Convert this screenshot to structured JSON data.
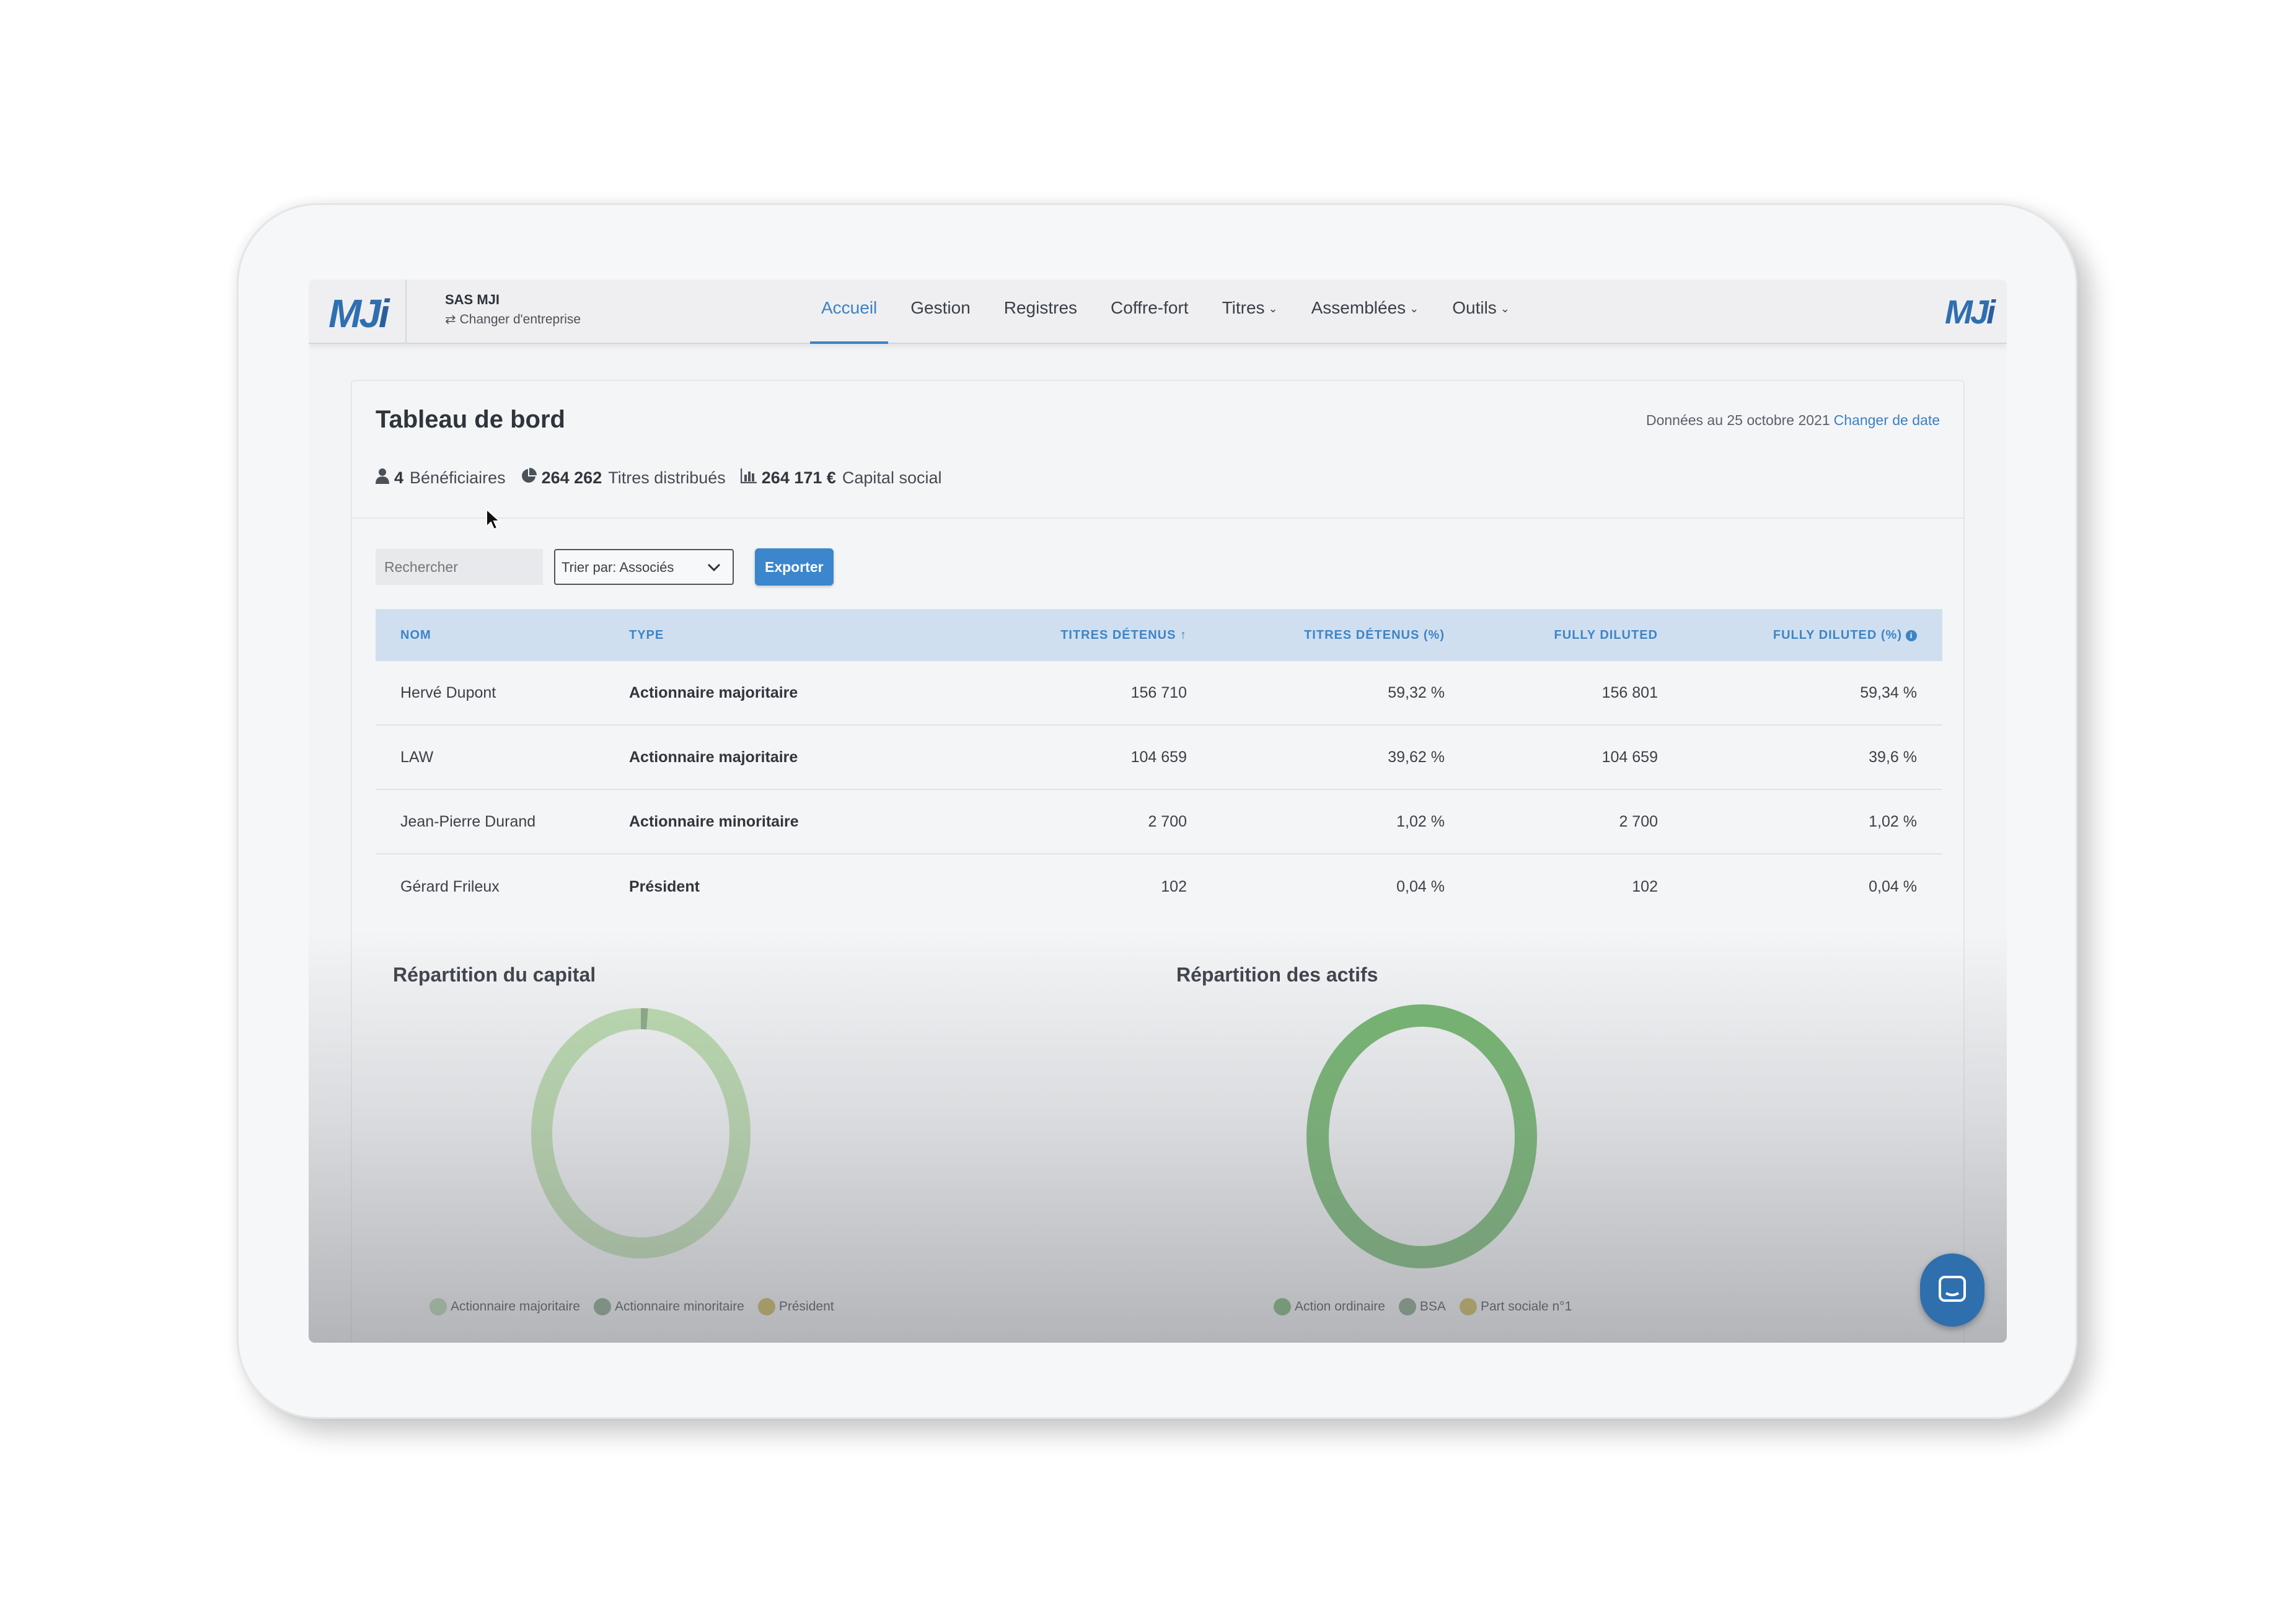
{
  "brand": {
    "logo_text": "MJ",
    "logo_accent": "i"
  },
  "company": {
    "name": "SAS MJI",
    "switch_label": "Changer d'entreprise"
  },
  "nav": {
    "items": [
      {
        "label": "Accueil",
        "active": true,
        "dropdown": false
      },
      {
        "label": "Gestion",
        "active": false,
        "dropdown": false
      },
      {
        "label": "Registres",
        "active": false,
        "dropdown": false
      },
      {
        "label": "Coffre-fort",
        "active": false,
        "dropdown": false
      },
      {
        "label": "Titres",
        "active": false,
        "dropdown": true
      },
      {
        "label": "Assemblées",
        "active": false,
        "dropdown": true
      },
      {
        "label": "Outils",
        "active": false,
        "dropdown": true
      }
    ]
  },
  "dashboard": {
    "title": "Tableau de bord",
    "date_text": "Données au 25 octobre 2021",
    "change_date_label": "Changer de date",
    "stats": {
      "beneficiaries_value": "4",
      "beneficiaries_label": "Bénéficiaires",
      "titres_value": "264 262",
      "titres_label": "Titres distribués",
      "capital_value": "264 171 €",
      "capital_label": "Capital social"
    },
    "search_placeholder": "Rechercher",
    "sort_label": "Trier par: Associés",
    "export_label": "Exporter"
  },
  "table": {
    "headers": {
      "nom": "NOM",
      "type": "TYPE",
      "titres": "TITRES DÉTENUS",
      "titres_pct": "TITRES DÉTENUS (%)",
      "fd": "FULLY DILUTED",
      "fd_pct": "FULLY DILUTED (%)"
    },
    "rows": [
      {
        "nom": "Hervé Dupont",
        "type": "Actionnaire majoritaire",
        "titres": "156 710",
        "titres_pct": "59,32 %",
        "fd": "156 801",
        "fd_pct": "59,34 %"
      },
      {
        "nom": "LAW",
        "type": "Actionnaire majoritaire",
        "titres": "104 659",
        "titres_pct": "39,62 %",
        "fd": "104 659",
        "fd_pct": "39,6 %"
      },
      {
        "nom": "Jean-Pierre Durand",
        "type": "Actionnaire minoritaire",
        "titres": "2 700",
        "titres_pct": "1,02 %",
        "fd": "2 700",
        "fd_pct": "1,02 %"
      },
      {
        "nom": "Gérard Frileux",
        "type": "Président",
        "titres": "102",
        "titres_pct": "0,04 %",
        "fd": "102",
        "fd_pct": "0,04 %"
      }
    ]
  },
  "charts": {
    "capital": {
      "title": "Répartition du capital",
      "legend": [
        {
          "label": "Actionnaire majoritaire",
          "color": "#b3d3a8"
        },
        {
          "label": "Actionnaire minoritaire",
          "color": "#7e9e7e"
        },
        {
          "label": "Président",
          "color": "#c6b14a"
        }
      ],
      "slices": [
        {
          "label": "Actionnaire majoritaire",
          "value": 98.94,
          "color": "#bcdcaf"
        },
        {
          "label": "Actionnaire minoritaire",
          "value": 1.02,
          "color": "#8aa88a"
        },
        {
          "label": "Président",
          "value": 0.04,
          "color": "#c6b14a"
        }
      ]
    },
    "actifs": {
      "title": "Répartition des actifs",
      "legend": [
        {
          "label": "Action ordinaire",
          "color": "#6fae6a"
        },
        {
          "label": "BSA",
          "color": "#7c9a7c"
        },
        {
          "label": "Part sociale n°1",
          "color": "#c9b34c"
        }
      ],
      "slices": [
        {
          "label": "Action ordinaire",
          "value": 100,
          "color": "#72b66d"
        }
      ]
    }
  },
  "chart_data": [
    {
      "type": "pie",
      "title": "Répartition du capital",
      "categories": [
        "Actionnaire majoritaire",
        "Actionnaire minoritaire",
        "Président"
      ],
      "values": [
        98.94,
        1.02,
        0.04
      ],
      "legend": "bottom"
    },
    {
      "type": "pie",
      "title": "Répartition des actifs",
      "categories": [
        "Action ordinaire",
        "BSA",
        "Part sociale n°1"
      ],
      "values": [
        100,
        0,
        0
      ],
      "legend": "bottom"
    }
  ]
}
